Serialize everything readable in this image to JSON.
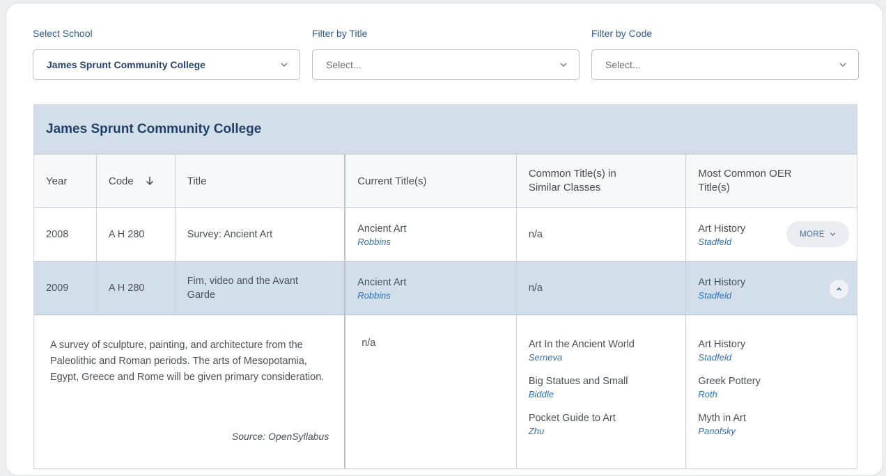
{
  "filters": {
    "school": {
      "label": "Select School",
      "value": "James Sprunt Community College"
    },
    "title": {
      "label": "Filter by Title",
      "placeholder": "Select..."
    },
    "code": {
      "label": "Filter by Code",
      "placeholder": "Select..."
    }
  },
  "table": {
    "school_name": "James Sprunt Community College",
    "columns": [
      "Year",
      "Code",
      "Title",
      "Current Title(s)",
      "Common Title(s) in Similar Classes",
      "Most Common OER Title(s)"
    ],
    "rows": [
      {
        "year": "2008",
        "code": "A H 280",
        "title": "Survey: Ancient Art",
        "current_title": "Ancient Art",
        "current_author": "Robbins",
        "common": "n/a",
        "oer_title": "Art History",
        "oer_author": "Stadfeld",
        "more_label": "MORE"
      },
      {
        "year": "2009",
        "code": "A H 280",
        "title": "Fim, video and the Avant Garde",
        "current_title": "Ancient Art",
        "current_author": "Robbins",
        "common": "n/a",
        "oer_title": "Art History",
        "oer_author": "Stadfeld"
      }
    ],
    "detail": {
      "description": "A survey of sculpture, painting, and architecture from the Paleolithic and Roman periods. The arts of Mesopotamia, Egypt, Greece and Rome will be given primary consideration.",
      "source": "Source: OpenSyllabus",
      "current": "n/a",
      "common_titles": [
        {
          "title": "Art In the Ancient World",
          "author": "Serneva"
        },
        {
          "title": "Big Statues and Small",
          "author": "Biddle"
        },
        {
          "title": "Pocket Guide to Art",
          "author": "Zhu"
        }
      ],
      "oer_titles": [
        {
          "title": "Art History",
          "author": "Stadfeld"
        },
        {
          "title": "Greek Pottery",
          "author": "Roth"
        },
        {
          "title": "Myth in Art",
          "author": "Panofsky"
        }
      ]
    }
  }
}
